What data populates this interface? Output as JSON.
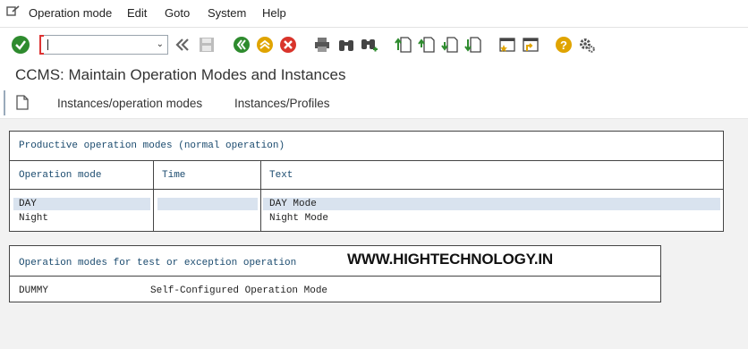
{
  "menu": {
    "items": [
      {
        "label": "Operation mode"
      },
      {
        "label": "Edit"
      },
      {
        "label": "Goto"
      },
      {
        "label": "System"
      },
      {
        "label": "Help"
      }
    ]
  },
  "toolbar": {
    "command_field_value": "",
    "icons": [
      "enter-icon",
      "back-nav-icon",
      "save-icon",
      "back-icon",
      "exit-icon",
      "cancel-icon",
      "print-icon",
      "find-icon",
      "find-next-icon",
      "first-page-icon",
      "previous-page-icon",
      "next-page-icon",
      "last-page-icon",
      "create-session-icon",
      "shortcut-icon",
      "help-icon",
      "settings-icon"
    ],
    "colors": {
      "enter": "#2e8b2e",
      "back": "#2e8b2e",
      "exit": "#e0a400",
      "cancel": "#d9342b",
      "help": "#e0a400"
    }
  },
  "page": {
    "title": "CCMS: Maintain Operation Modes and Instances"
  },
  "tabs": [
    {
      "label": "Instances/operation modes"
    },
    {
      "label": "Instances/Profiles"
    }
  ],
  "productive": {
    "heading": "Productive operation modes (normal operation)",
    "columns": [
      "Operation mode",
      "Time",
      "Text"
    ],
    "rows": [
      {
        "mode": "DAY",
        "time": "",
        "text": "DAY Mode"
      },
      {
        "mode": "Night",
        "time": "",
        "text": "Night Mode"
      }
    ]
  },
  "test": {
    "heading": "Operation modes for test or exception operation",
    "rows": [
      {
        "mode": "DUMMY",
        "text": "Self-Configured Operation Mode"
      }
    ]
  },
  "watermark": "WWW.HIGHTECHNOLOGY.IN"
}
